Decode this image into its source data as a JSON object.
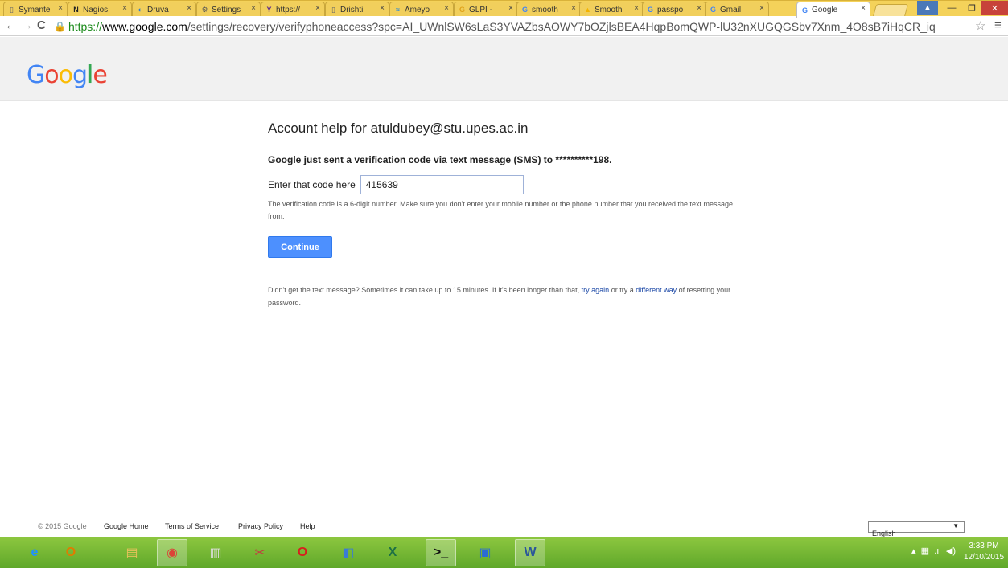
{
  "browser": {
    "tabs": [
      {
        "title": "Symante",
        "favicon": "page-icon",
        "icon_glyph": "▯",
        "icon_color": "#666666"
      },
      {
        "title": "Nagios",
        "favicon": "nagios-icon",
        "icon_glyph": "N",
        "icon_color": "#222222"
      },
      {
        "title": "Druva",
        "favicon": "druva-icon",
        "icon_glyph": "◐",
        "icon_color": "#2a7bd4"
      },
      {
        "title": "Settings",
        "favicon": "gear-icon",
        "icon_glyph": "⚙",
        "icon_color": "#555555"
      },
      {
        "title": "https://",
        "favicon": "yahoo-icon",
        "icon_glyph": "Y",
        "icon_color": "#5f2a8c"
      },
      {
        "title": "Drishti",
        "favicon": "page-icon",
        "icon_glyph": "▯",
        "icon_color": "#666666"
      },
      {
        "title": "Ameyo",
        "favicon": "ameyo-icon",
        "icon_glyph": "≈",
        "icon_color": "#3a8fd0"
      },
      {
        "title": "GLPI -",
        "favicon": "glpi-icon",
        "icon_glyph": "G",
        "icon_color": "#e0a21a"
      },
      {
        "title": "smooth",
        "favicon": "google-icon",
        "icon_glyph": "G",
        "icon_color": "#4285f4"
      },
      {
        "title": "Smooth",
        "favicon": "drive-icon",
        "icon_glyph": "▲",
        "icon_color": "#f4b400"
      },
      {
        "title": "passpo",
        "favicon": "google-icon",
        "icon_glyph": "G",
        "icon_color": "#4285f4"
      },
      {
        "title": "Gmail",
        "favicon": "google-icon",
        "icon_glyph": "G",
        "icon_color": "#4285f4"
      },
      {
        "title": "Google",
        "favicon": "google-icon",
        "icon_glyph": "G",
        "icon_color": "#4285f4",
        "active": true
      }
    ],
    "url": {
      "scheme": "https://",
      "host": "www.google.com",
      "path": "/settings/recovery/verifyphoneaccess?spc=AI_UWnlSW6sLaS3YVAZbsAOWY7bOZjlsBEA4HqpBomQWP-lU32nXUGQGSbv7Xnm_4O8sB7iHqCR_iq"
    }
  },
  "logo": {
    "letters": [
      {
        "ch": "G",
        "color": "#4285f4"
      },
      {
        "ch": "o",
        "color": "#ea4335"
      },
      {
        "ch": "o",
        "color": "#fbbc05"
      },
      {
        "ch": "g",
        "color": "#4285f4"
      },
      {
        "ch": "l",
        "color": "#34a853"
      },
      {
        "ch": "e",
        "color": "#ea4335"
      }
    ]
  },
  "main": {
    "heading": "Account help for atuldubey@stu.upes.ac.in",
    "sent_message": "Google just sent a verification code via text message (SMS) to **********198.",
    "code_label": "Enter that code here",
    "code_value": "415639",
    "hint": "The verification code is a 6-digit number. Make sure you don't enter your mobile number or the phone number that you received the text message from.",
    "continue_label": "Continue",
    "resend_prefix": "Didn't get the text message? Sometimes it can take up to 15 minutes. If it's been longer than that,",
    "try_again": "try again",
    "resend_mid": "or try a",
    "different_way": "different way",
    "resend_suffix": "of resetting your password."
  },
  "footer": {
    "copyright": "© 2015 Google",
    "links": [
      "Google Home",
      "Terms of Service",
      "Privacy Policy",
      "Help"
    ],
    "language": "English"
  },
  "taskbar": {
    "time": "3:33 PM",
    "date": "12/10/2015",
    "apps": [
      {
        "name": "ie-icon",
        "glyph": "e",
        "color": "#1e90ff"
      },
      {
        "name": "outlook-icon",
        "glyph": "O",
        "color": "#e07b00"
      },
      {
        "name": "file-explorer-icon",
        "glyph": "▤",
        "color": "#e8c15a"
      },
      {
        "name": "chrome-icon",
        "glyph": "◉",
        "color": "#db4437"
      },
      {
        "name": "server-manager-icon",
        "glyph": "▥",
        "color": "#dddddd"
      },
      {
        "name": "snipping-tool-icon",
        "glyph": "✂",
        "color": "#c04040"
      },
      {
        "name": "opera-icon",
        "glyph": "O",
        "color": "#d81e1e"
      },
      {
        "name": "media-icon",
        "glyph": "◧",
        "color": "#3a7bd5"
      },
      {
        "name": "excel-icon",
        "glyph": "X",
        "color": "#1e7145"
      },
      {
        "name": "cmd-icon",
        "glyph": ">_",
        "color": "#111111"
      },
      {
        "name": "remote-desktop-icon",
        "glyph": "▣",
        "color": "#2b6cd4"
      },
      {
        "name": "word-icon",
        "glyph": "W",
        "color": "#2b579a"
      }
    ]
  }
}
